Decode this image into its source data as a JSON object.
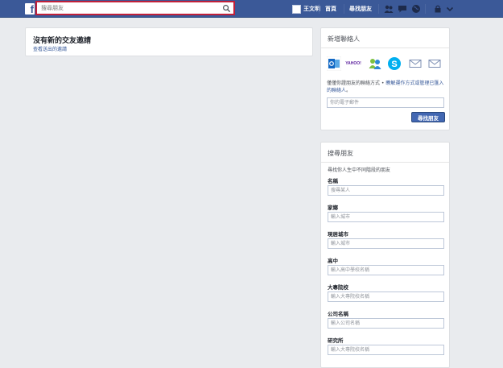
{
  "header": {
    "search_placeholder": "搜尋朋友",
    "user_name": "王文明",
    "home_label": "首頁",
    "find_friends_label": "尋找朋友"
  },
  "requests": {
    "title": "沒有新的交友邀請",
    "sent_link": "查看送出的邀請"
  },
  "add_contacts": {
    "title": "新增聯絡人",
    "providers": [
      "outlook-icon",
      "yahoo-icon",
      "windows-live-messenger-icon",
      "skype-icon",
      "email-icon",
      "other-email-icon"
    ],
    "yahoo_text": "YAHOO!",
    "desc_part1": "僅僅你證朋友的聯絡方式 • ",
    "desc_link": "瞭解運作方式或管理已匯入的聯絡人",
    "desc_end": "。",
    "email_placeholder": "你的電子郵件",
    "button": "尋找朋友"
  },
  "search_friends": {
    "title": "搜尋朋友",
    "subtitle": "尋找你人生中不同階段的朋友",
    "fields": [
      {
        "label": "名稱",
        "placeholder": "搜尋某人"
      },
      {
        "label": "家鄉",
        "placeholder": "輸入城市"
      },
      {
        "label": "現居城市",
        "placeholder": "輸入城市"
      },
      {
        "label": "高中",
        "placeholder": "輸入高中學校名稱"
      },
      {
        "label": "大專院校",
        "placeholder": "輸入大專院校名稱"
      },
      {
        "label": "公司名稱",
        "placeholder": "輸入公司名稱"
      },
      {
        "label": "研究所",
        "placeholder": "輸入大專院校名稱"
      }
    ]
  },
  "colors": {
    "brand": "#3b5998",
    "highlight": "#c0203a",
    "link": "#365899"
  }
}
